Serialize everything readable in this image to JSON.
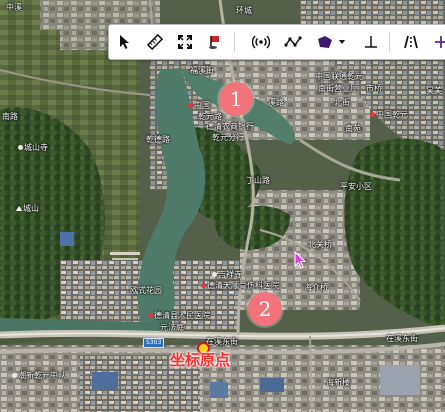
{
  "toolbar": {
    "tools": [
      {
        "name": "select-pointer",
        "icon": "arrow-pointer-icon"
      },
      {
        "name": "measure-ruler",
        "icon": "ruler-icon"
      },
      {
        "name": "fullscreen",
        "icon": "fullscreen-icon"
      },
      {
        "name": "place-marker",
        "icon": "flag-marker-icon"
      },
      {
        "name": "signal-point",
        "icon": "broadcast-icon"
      },
      {
        "name": "draw-polyline",
        "icon": "polyline-icon"
      },
      {
        "name": "draw-polygon",
        "icon": "polygon-icon"
      },
      {
        "name": "perpendicular",
        "icon": "perpendicular-icon"
      },
      {
        "name": "road-profile",
        "icon": "road-icon"
      }
    ]
  },
  "markers": [
    {
      "number": "1"
    },
    {
      "number": "2"
    }
  ],
  "origin": {
    "label": "坐标原点"
  },
  "labels": {
    "north_top": "中溪",
    "top_road": "环城",
    "top_left_road": "南路",
    "fuqian_street": "福溪街",
    "china_unicom": "中国联通乾元",
    "nanjie": "南街营业厅",
    "lanxi_road": "溪路",
    "beihou": "北街",
    "nanyuan": "南苑",
    "shifuqiao": "市桥",
    "shoumeng": "昊美",
    "china_bank": "中国",
    "gan_road": "乾元路",
    "deqing_bank": "德清农商银行",
    "qianyuan_branch": "乾元分行",
    "gandan_road": "乾德路",
    "industrial": "乾元镇政府",
    "qianyuan_china": "中国乾元",
    "cheng_shan_si": "城山寺",
    "cheng_shan": "城山",
    "lianhua_road": "莲花路",
    "dingshan_road": "丁山路",
    "pingan_road": "平安小区",
    "beiguan": "北关桥",
    "jixiang_si": "吉祥寺",
    "hospital": "德清天顺骨伤科医院",
    "jiaqiao": "海介桥",
    "jiuqian": "欧式花园",
    "people_hospital": "德清县人民医院",
    "yuanfa": "元法庭",
    "east_street": "在溪东街",
    "east_street_2": "在溪东街",
    "road_shield": "S303",
    "qianyuan_middle": "潮新乾元中队",
    "haiqiao": "海新楼"
  }
}
